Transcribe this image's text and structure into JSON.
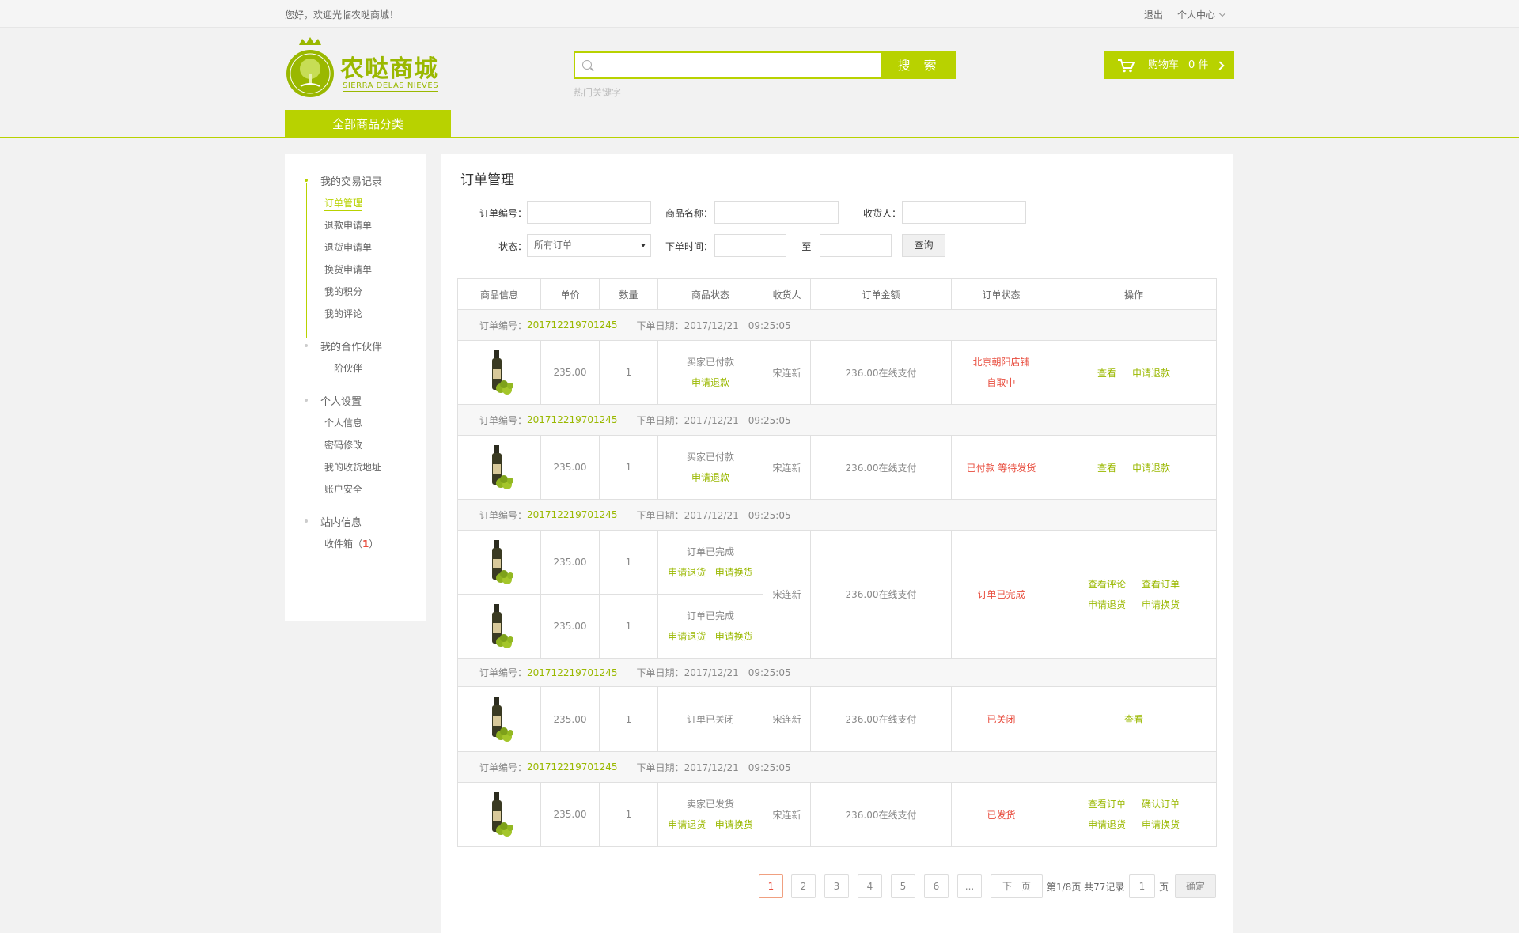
{
  "topbar": {
    "welcome": "您好，欢迎光临农哒商城！",
    "logout": "退出",
    "user_center": "个人中心"
  },
  "logo": {
    "name": "农哒商城",
    "sub": "SIERRA DELAS NIEVES"
  },
  "search": {
    "button": "搜 索",
    "hot_keywords": "热门关键字"
  },
  "cart": {
    "label": "购物车",
    "count": "0 件"
  },
  "all_categories": "全部商品分类",
  "sidebar": {
    "groups": [
      {
        "title": "我的交易记录",
        "items": [
          "订单管理",
          "退款申请单",
          "退货申请单",
          "换货申请单",
          "我的积分",
          "我的评论"
        ]
      },
      {
        "title": "我的合作伙伴",
        "items": [
          "一阶伙伴"
        ]
      },
      {
        "title": "个人设置",
        "items": [
          "个人信息",
          "密码修改",
          "我的收货地址",
          "账户安全"
        ]
      },
      {
        "title": "站内信息",
        "items": [
          "收件箱（",
          "1",
          "）"
        ]
      }
    ]
  },
  "main": {
    "title": "订单管理",
    "filters": {
      "order_no_label": "订单编号：",
      "product_name_label": "商品名称：",
      "receiver_label": "收货人：",
      "status_label": "状态：",
      "status_value": "所有订单",
      "order_time_label": "下单时间：",
      "to": "--至--",
      "query": "查询"
    },
    "headers": [
      "商品信息",
      "单价",
      "数量",
      "商品状态",
      "收货人",
      "订单金额",
      "订单状态",
      "操作"
    ],
    "order_no_prefix": "订单编号：",
    "order_date_prefix": "下单日期：",
    "orders": [
      {
        "no": "201712219701245",
        "date": "2017/12/21　09:25:05",
        "price": "235.00",
        "qty": "1",
        "item_status": "买家已付款",
        "item_action": "申请退款",
        "receiver": "宋连新",
        "amount": "236.00在线支付",
        "status1": "北京朝阳店铺",
        "status2": "自取中",
        "op1": "查看",
        "op2": "申请退款"
      },
      {
        "no": "201712219701245",
        "date": "2017/12/21　09:25:05",
        "price": "235.00",
        "qty": "1",
        "item_status": "买家已付款",
        "item_action": "申请退款",
        "receiver": "宋连新",
        "amount": "236.00在线支付",
        "status": "已付款 等待发货",
        "op1": "查看",
        "op2": "申请退款"
      },
      {
        "no": "201712219701245",
        "date": "2017/12/21　09:25:05",
        "price": "235.00",
        "qty": "1",
        "item_status": "订单已完成",
        "item_a1": "申请退货",
        "item_a2": "申请换货",
        "price2": "235.00",
        "qty2": "1",
        "item_status2": "订单已完成",
        "item2_a1": "申请退货",
        "item2_a2": "申请换货",
        "receiver": "宋连新",
        "amount": "236.00在线支付",
        "status": "订单已完成",
        "op1": "查看评论",
        "op2": "查看订单",
        "op3": "申请退货",
        "op4": "申请换货"
      },
      {
        "no": "201712219701245",
        "date": "2017/12/21　09:25:05",
        "price": "235.00",
        "qty": "1",
        "item_status": "订单已关闭",
        "receiver": "宋连新",
        "amount": "236.00在线支付",
        "status": "已关闭",
        "op1": "查看"
      },
      {
        "no": "201712219701245",
        "date": "2017/12/21　09:25:05",
        "price": "235.00",
        "qty": "1",
        "item_status": "卖家已发货",
        "item_a1": "申请退货",
        "item_a2": "申请换货",
        "receiver": "宋连新",
        "amount": "236.00在线支付",
        "status": "已发货",
        "op1": "查看订单",
        "op2": "确认订单",
        "op3": "申请退货",
        "op4": "申请换货"
      }
    ],
    "pager": {
      "pages": [
        "1",
        "2",
        "3",
        "4",
        "5",
        "6",
        "..."
      ],
      "next": "下一页",
      "summary": "第1/8页 共77记录",
      "page_input": "1",
      "page_unit": "页",
      "confirm": "确定"
    }
  },
  "colors": {
    "accent": "#b8d200",
    "accent_text": "#9ab800",
    "alert": "#e84c3d"
  }
}
